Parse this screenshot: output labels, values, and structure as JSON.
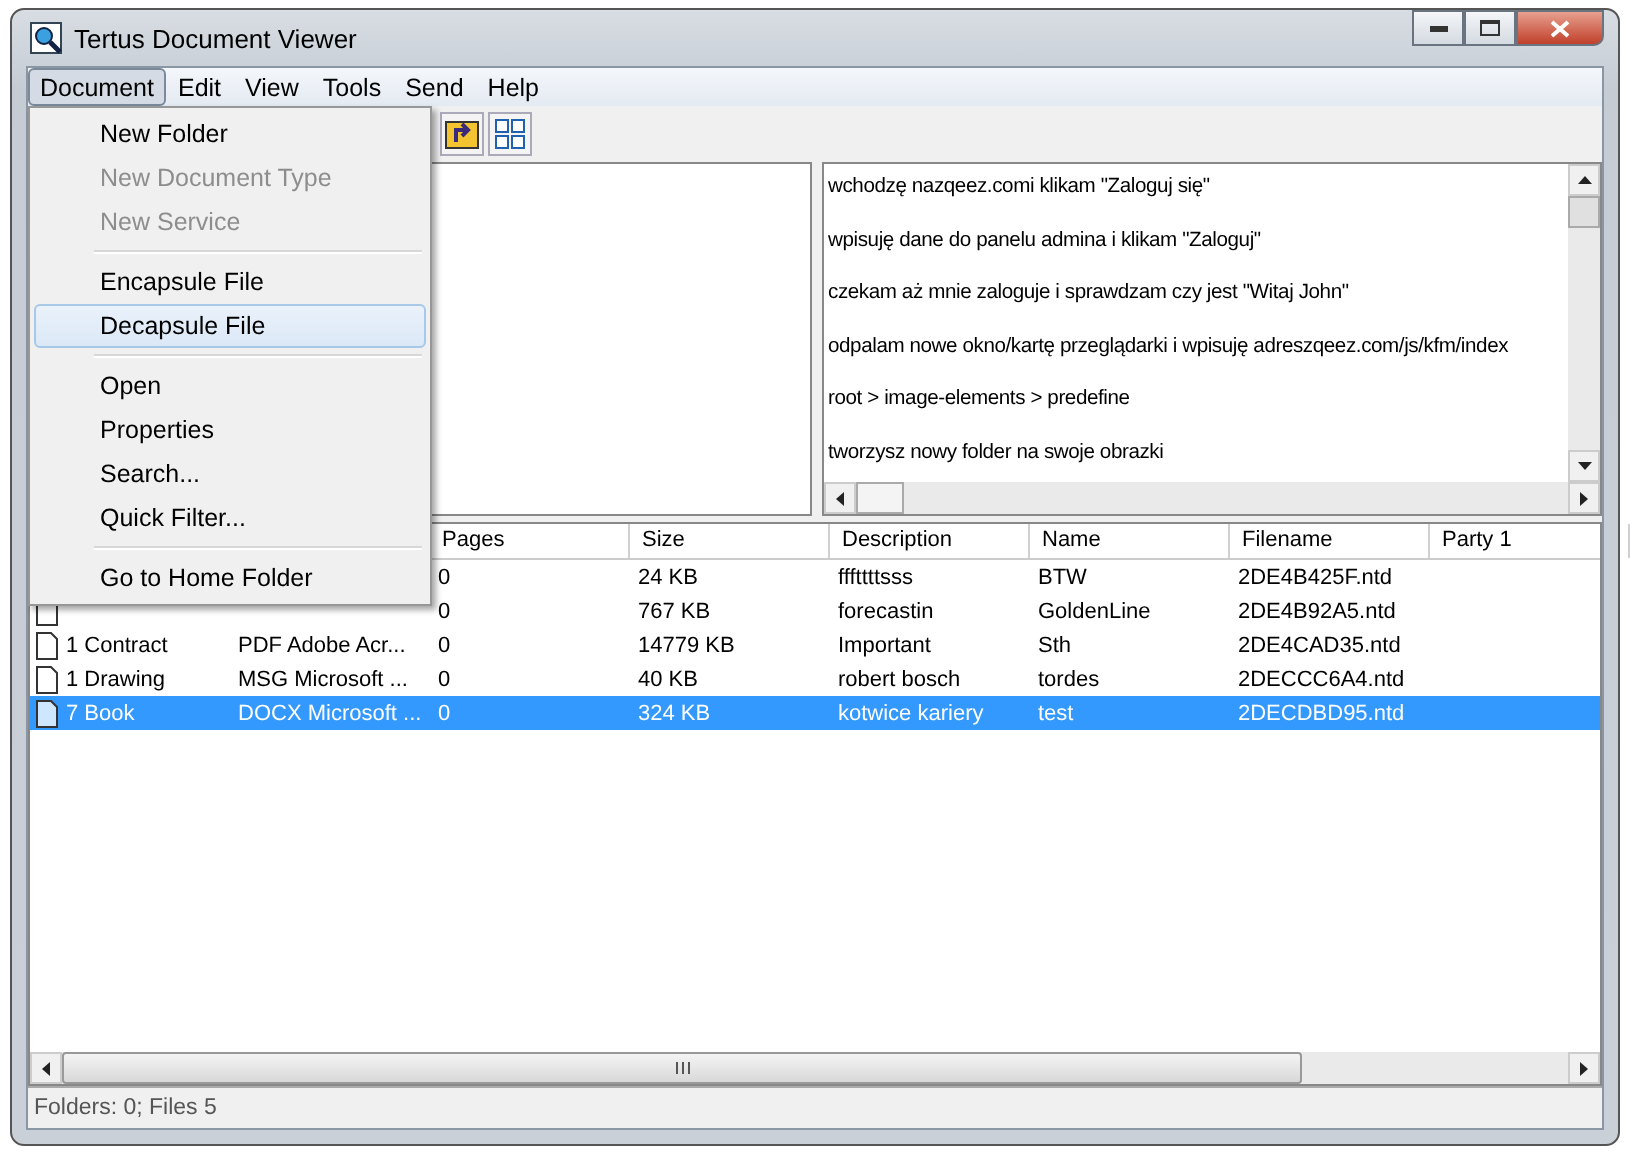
{
  "window": {
    "title": "Tertus Document Viewer"
  },
  "menubar": [
    {
      "label": "Document",
      "selected": true
    },
    {
      "label": "Edit",
      "selected": false
    },
    {
      "label": "View",
      "selected": false
    },
    {
      "label": "Tools",
      "selected": false
    },
    {
      "label": "Send",
      "selected": false
    },
    {
      "label": "Help",
      "selected": false
    }
  ],
  "menu": [
    {
      "kind": "item",
      "label": "New Folder",
      "disabled": false,
      "selected": false
    },
    {
      "kind": "item",
      "label": "New Document Type",
      "disabled": true,
      "selected": false
    },
    {
      "kind": "item",
      "label": "New Service",
      "disabled": true,
      "selected": false
    },
    {
      "kind": "separator"
    },
    {
      "kind": "item",
      "label": "Encapsule File",
      "disabled": false,
      "selected": false
    },
    {
      "kind": "item",
      "label": "Decapsule File",
      "disabled": false,
      "selected": true
    },
    {
      "kind": "separator"
    },
    {
      "kind": "item",
      "label": "Open",
      "disabled": false,
      "selected": false
    },
    {
      "kind": "item",
      "label": "Properties",
      "disabled": false,
      "selected": false
    },
    {
      "kind": "item",
      "label": "Search...",
      "disabled": false,
      "selected": false
    },
    {
      "kind": "item",
      "label": "Quick Filter...",
      "disabled": false,
      "selected": false
    },
    {
      "kind": "separator"
    },
    {
      "kind": "item",
      "label": "Go to Home Folder",
      "disabled": false,
      "selected": false
    }
  ],
  "notes": [
    "wchodzę nazqeez.comi klikam \"Zaloguj się\"",
    "wpisuję dane do panelu admina i klikam \"Zaloguj\"",
    "czekam aż mnie zaloguje i sprawdzam czy jest \"Witaj John\"",
    "odpalam nowe okno/kartę przeglądarki i wpisuję adreszqeez.com/js/kfm/index",
    "root > image-elements > predefine",
    "tworzysz nowy folder na swoje obrazki"
  ],
  "table": {
    "columns": [
      "Pages",
      "Size",
      "Description",
      "Name",
      "Filename",
      "Party 1"
    ],
    "rows": [
      {
        "selected": false,
        "pages": "0",
        "size": "24 KB",
        "description": "fffttttsss",
        "name": "BTW",
        "filename": "2DE4B425F.ntd"
      },
      {
        "selected": false,
        "kind": "document",
        "pages": "0",
        "size": "767 KB",
        "description": "forecastin",
        "name": "GoldenLine",
        "filename": "2DE4B92A5.ntd"
      },
      {
        "selected": false,
        "kind": "document",
        "type": "1 Contract",
        "format": "PDF Adobe Acr...",
        "pages": "0",
        "size": "14779 KB",
        "description": "Important",
        "name": "Sth",
        "filename": "2DE4CAD35.ntd"
      },
      {
        "selected": false,
        "kind": "document",
        "type": "1 Drawing",
        "format": "MSG Microsoft ...",
        "pages": "0",
        "size": "40 KB",
        "description": "robert bosch",
        "name": "tordes",
        "filename": "2DECCC6A4.ntd"
      },
      {
        "selected": true,
        "kind": "document",
        "type": "7 Book",
        "format": "DOCX Microsoft ...",
        "pages": "0",
        "size": "324 KB",
        "description": "kotwice kariery",
        "name": "test",
        "filename": "2DECDBD95.ntd"
      }
    ]
  },
  "status_bar": "Folders: 0; Files 5"
}
